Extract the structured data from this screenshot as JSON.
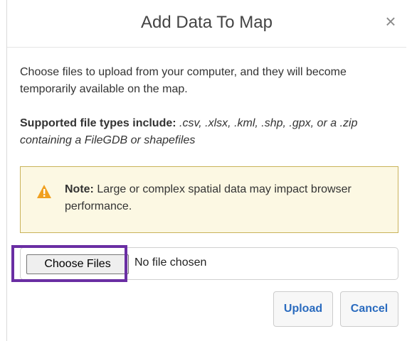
{
  "dialog": {
    "title": "Add Data To Map",
    "close_glyph": "×",
    "intro": "Choose files to upload from your computer, and they will become temporarily available on the map.",
    "supported_label": "Supported file types include:",
    "supported_types": " .csv, .xlsx, .kml, .shp, .gpx, or a .zip containing a FileGDB or shapefiles",
    "note": {
      "label": "Note:",
      "text": " Large or complex spatial data may impact browser performance.",
      "icon": "warning-icon"
    },
    "file_input": {
      "button_label": "Choose Files",
      "status": "No file chosen"
    },
    "upload_label": "Upload",
    "cancel_label": "Cancel"
  },
  "colors": {
    "note_background": "#fcf8e3",
    "note_border": "#c9b35a",
    "warning_icon": "#f0a020",
    "highlight": "#6a2ea3",
    "button_text": "#2a6bbf"
  }
}
